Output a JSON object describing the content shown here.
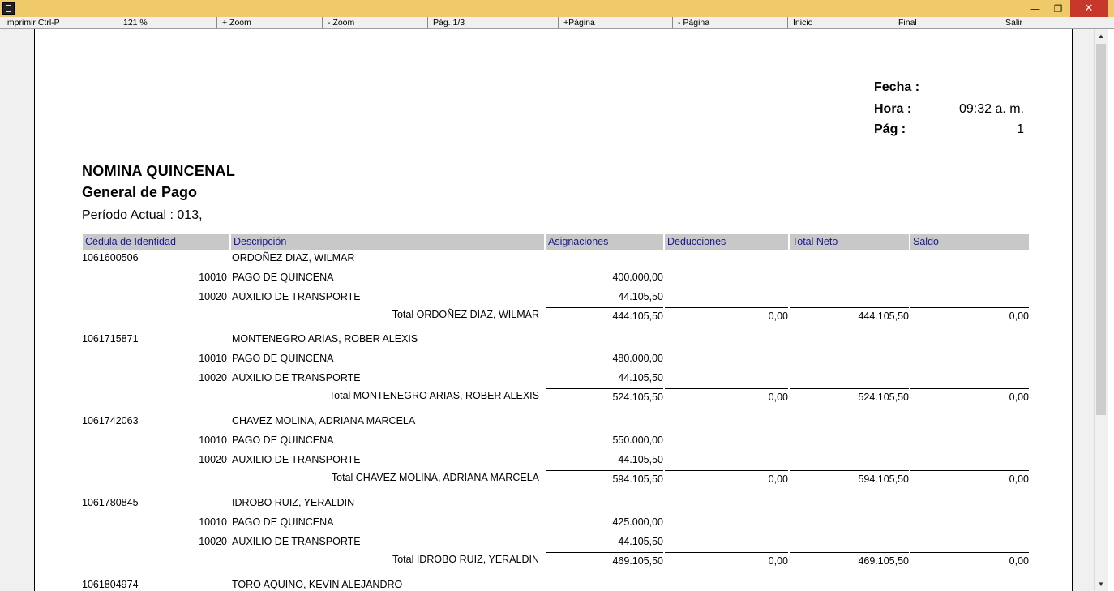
{
  "toolbar": {
    "buttons": [
      "Imprimir Ctrl-P",
      "121 %",
      "+ Zoom",
      "- Zoom",
      "Pág. 1/3",
      "+Página",
      "- Página",
      "Inicio",
      "Final",
      "Salir"
    ]
  },
  "report": {
    "header": {
      "fecha_label": "Fecha :",
      "fecha_value": "",
      "hora_label": "Hora :",
      "hora_value": "09:32 a. m.",
      "pag_label": "Pág :",
      "pag_value": "1"
    },
    "title": "NOMINA QUINCENAL",
    "subtitle": "General de Pago",
    "period": "Período Actual :  013,",
    "columns": [
      "Cédula de Identidad",
      "Descripción",
      "Asignaciones",
      "Deducciones",
      "Total Neto",
      "Saldo"
    ],
    "employees": [
      {
        "id": "1061600506",
        "name": "ORDOÑEZ DIAZ, WILMAR",
        "lines": [
          {
            "code": "10010",
            "desc": "PAGO DE  QUINCENA",
            "amount": "400.000,00"
          },
          {
            "code": "10020",
            "desc": "AUXILIO DE TRANSPORTE",
            "amount": "44.105,50"
          }
        ],
        "total_label": "Total ORDOÑEZ DIAZ, WILMAR",
        "total_asig": "444.105,50",
        "total_ded": "0,00",
        "total_neto": "444.105,50",
        "total_saldo": "0,00"
      },
      {
        "id": "1061715871",
        "name": "MONTENEGRO ARIAS, ROBER ALEXIS",
        "lines": [
          {
            "code": "10010",
            "desc": "PAGO DE  QUINCENA",
            "amount": "480.000,00"
          },
          {
            "code": "10020",
            "desc": "AUXILIO DE TRANSPORTE",
            "amount": "44.105,50"
          }
        ],
        "total_label": "Total MONTENEGRO ARIAS, ROBER ALEXIS",
        "total_asig": "524.105,50",
        "total_ded": "0,00",
        "total_neto": "524.105,50",
        "total_saldo": "0,00"
      },
      {
        "id": "1061742063",
        "name": "CHAVEZ MOLINA, ADRIANA MARCELA",
        "lines": [
          {
            "code": "10010",
            "desc": "PAGO DE  QUINCENA",
            "amount": "550.000,00"
          },
          {
            "code": "10020",
            "desc": "AUXILIO DE TRANSPORTE",
            "amount": "44.105,50"
          }
        ],
        "total_label": "Total CHAVEZ MOLINA, ADRIANA MARCELA",
        "total_asig": "594.105,50",
        "total_ded": "0,00",
        "total_neto": "594.105,50",
        "total_saldo": "0,00"
      },
      {
        "id": "1061780845",
        "name": "IDROBO RUIZ, YERALDIN",
        "lines": [
          {
            "code": "10010",
            "desc": "PAGO DE  QUINCENA",
            "amount": "425.000,00"
          },
          {
            "code": "10020",
            "desc": "AUXILIO DE TRANSPORTE",
            "amount": "44.105,50"
          }
        ],
        "total_label": "Total IDROBO RUIZ, YERALDIN",
        "total_asig": "469.105,50",
        "total_ded": "0,00",
        "total_neto": "469.105,50",
        "total_saldo": "0,00"
      },
      {
        "id": "1061804974",
        "name": "TORO AQUINO, KEVIN ALEJANDRO",
        "lines": [],
        "total_label": "",
        "total_asig": "",
        "total_ded": "",
        "total_neto": "",
        "total_saldo": ""
      }
    ]
  }
}
